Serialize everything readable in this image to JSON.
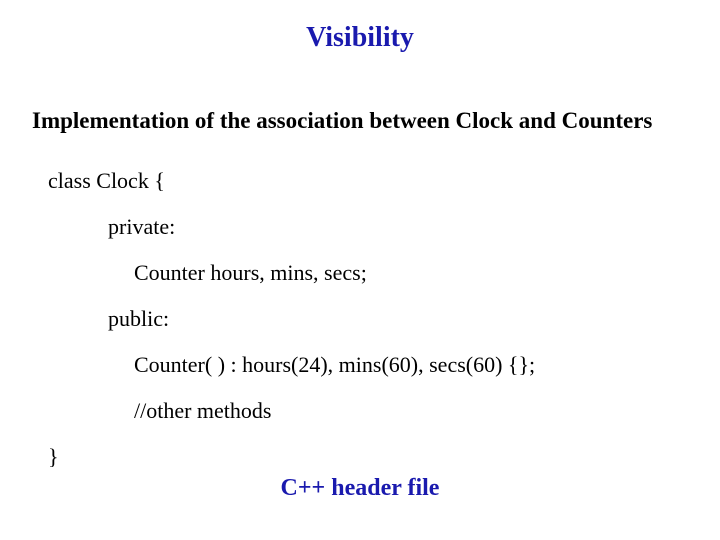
{
  "title": "Visibility",
  "subtitle": "Implementation of the association between Clock and Counters",
  "code": {
    "l1": "class Clock {",
    "l2": "private:",
    "l3": "Counter  hours, mins, secs;",
    "l4": "public:",
    "l5": "Counter( ) : hours(24), mins(60), secs(60) {};",
    "l6": "//other methods",
    "l7": "}"
  },
  "footer": "C++  header file"
}
